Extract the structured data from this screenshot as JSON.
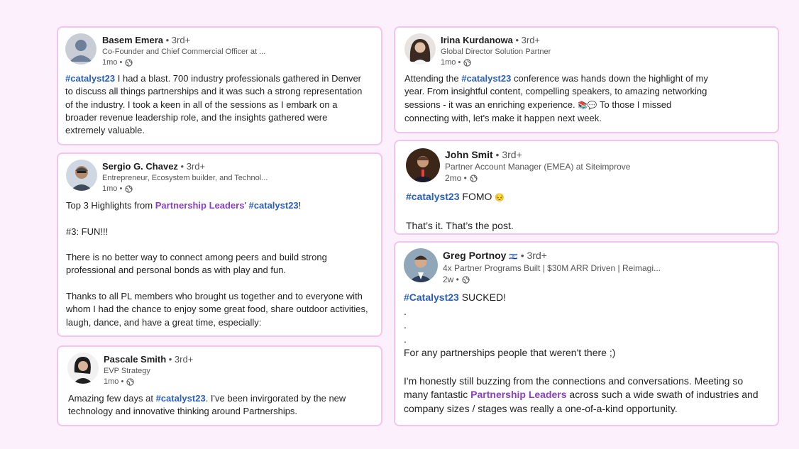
{
  "posts": {
    "basem": {
      "name": "Basem Emera",
      "degree": " • 3rd+",
      "title": "Co-Founder and Chief Commercial Officer at ...",
      "time": "1mo •",
      "tag": "#catalyst23",
      "text": " I had a blast. 700 industry professionals gathered in Denver to discuss all things partnerships and it was such a strong representation of the industry. I took a keen in all of the sessions as I embark on a broader revenue leadership role, and the insights gathered were extremely valuable."
    },
    "sergio": {
      "name": "Sergio G. Chavez",
      "degree": " • 3rd+",
      "title": "Entrepreneur, Ecosystem builder, and Technol...",
      "time": "1mo •",
      "line1_prefix": "Top 3 Highlights from ",
      "line1_mention": "Partnership Leaders",
      "line1_mid": "' ",
      "line1_tag": "#catalyst23",
      "line1_suffix": "!",
      "line2": "#3: FUN!!!",
      "para2": "There is no better way to connect among peers and build strong professional and personal bonds as with play and fun.",
      "para3": "Thanks to all PL members who brought us together and to everyone with whom I had the chance to enjoy some great food, share outdoor activities, laugh, dance, and have a great time, especially:"
    },
    "pascale": {
      "name": "Pascale Smith",
      "degree": " • 3rd+",
      "title": "EVP Strategy",
      "time": "1mo •",
      "prefix": "Amazing few days at ",
      "tag": "#catalyst23",
      "text": ". I've been invirgorated by the new technology and innovative thinking around Partnerships."
    },
    "irina": {
      "name": "Irina Kurdanowa",
      "degree": " • 3rd+",
      "title": "Global Director Solution Partner",
      "time": "1mo •",
      "prefix": "Attending the ",
      "tag": "#catalyst23",
      "text": " conference was hands down the highlight of my year. From insightful content, compelling speakers, to amazing networking sessions - it was an enriching experience. ",
      "emoji": "📚💬",
      "suffix": " To those I missed connecting with, let's make it happen next week."
    },
    "john": {
      "name": "John Smit",
      "degree": " • 3rd+",
      "title": "Partner Account Manager (EMEA) at Siteimprove",
      "time": "2mo •",
      "tag": "#catalyst23",
      "text": " FOMO ",
      "emoji": "😔",
      "line2": "That’s it. That’s the post."
    },
    "greg": {
      "name": "Greg Portnoy",
      "flag": "🇮🇱",
      "degree": " • 3rd+",
      "title": "4x Partner Programs Built | $30M ARR Driven | Reimagi...",
      "time": "2w •",
      "tag": "#Catalyst23",
      "text": " SUCKED!",
      "dot1": ".",
      "dot2": ".",
      "dot3": ".",
      "line_after": "For any partnerships people that weren't there ;)",
      "para_prefix": "I'm honestly still buzzing from the connections and conversations. Meeting so many fantastic ",
      "para_mention": "Partnership Leaders",
      "para_suffix": " across such a wide swath of industries and company sizes / stages was really a one-of-a-kind opportunity."
    }
  },
  "colors": {
    "background": "#fcf0fc",
    "card_border": "#f2c4f2",
    "hashtag": "#2b5fb8",
    "mention": "#8a3fbf"
  },
  "icons": [
    "globe-icon",
    "avatar"
  ]
}
